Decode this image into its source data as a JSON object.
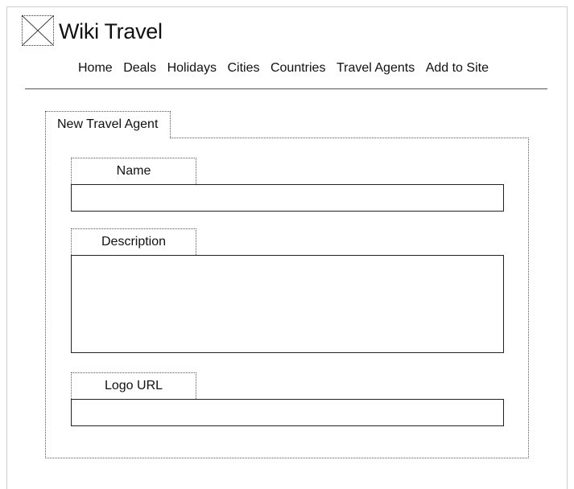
{
  "header": {
    "logo_icon": "image-placeholder-icon",
    "title": "Wiki Travel"
  },
  "nav": {
    "items": [
      {
        "label": "Home"
      },
      {
        "label": "Deals"
      },
      {
        "label": "Holidays"
      },
      {
        "label": "Cities"
      },
      {
        "label": "Countries"
      },
      {
        "label": "Travel Agents"
      },
      {
        "label": "Add to Site"
      }
    ]
  },
  "form": {
    "tab_label": "New Travel Agent",
    "fields": {
      "name": {
        "label": "Name",
        "value": ""
      },
      "description": {
        "label": "Description",
        "value": ""
      },
      "logo_url": {
        "label": "Logo URL",
        "value": ""
      }
    }
  }
}
